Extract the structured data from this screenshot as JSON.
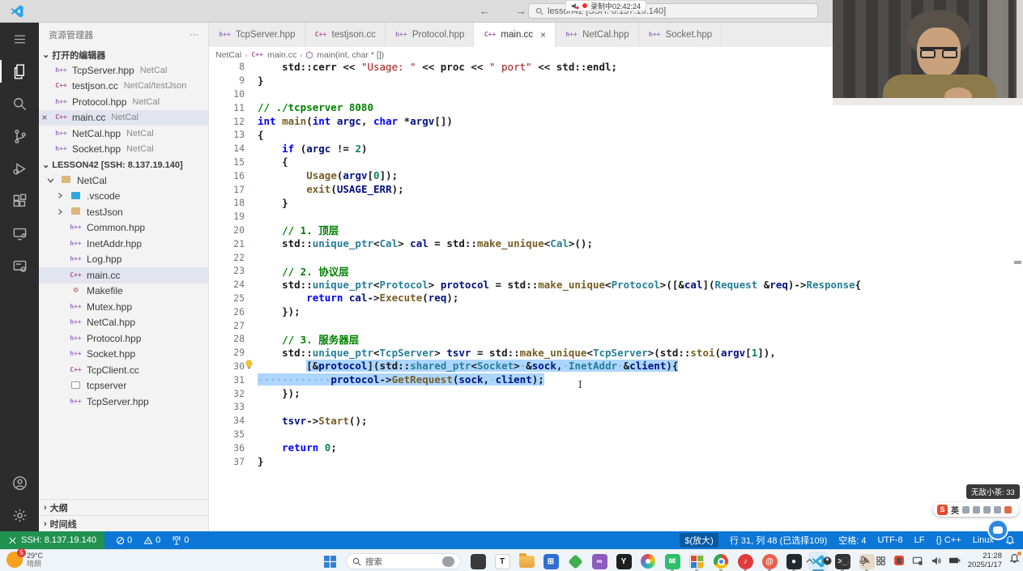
{
  "titlebar": {
    "search": "lesson42 [SSH: 8.137.19.140]",
    "recording": "录制中02:42:24"
  },
  "sidebar": {
    "title": "资源管理器",
    "more": "···",
    "close_glyph": "×",
    "open_editors_label": "打开的编辑器",
    "open_editors": [
      {
        "icon": "hpp",
        "name": "TcpServer.hpp",
        "path": "NetCal"
      },
      {
        "icon": "cc",
        "name": "testjson.cc",
        "path": "NetCal/testJson"
      },
      {
        "icon": "hpp",
        "name": "Protocol.hpp",
        "path": "NetCal"
      },
      {
        "icon": "cc",
        "name": "main.cc",
        "path": "NetCal",
        "active": true
      },
      {
        "icon": "hpp",
        "name": "NetCal.hpp",
        "path": "NetCal"
      },
      {
        "icon": "hpp",
        "name": "Socket.hpp",
        "path": "NetCal"
      }
    ],
    "workspace_label": "LESSON42 [SSH: 8.137.19.140]",
    "tree": [
      {
        "icon": "folder-open",
        "name": "NetCal",
        "level": 0,
        "chevron": "down"
      },
      {
        "icon": "vscode",
        "name": ".vscode",
        "level": 1,
        "chevron": "right"
      },
      {
        "icon": "folder",
        "name": "testJson",
        "level": 1,
        "chevron": "right"
      },
      {
        "icon": "hpp",
        "name": "Common.hpp",
        "level": 1
      },
      {
        "icon": "hpp",
        "name": "InetAddr.hpp",
        "level": 1
      },
      {
        "icon": "hpp",
        "name": "Log.hpp",
        "level": 1
      },
      {
        "icon": "cc",
        "name": "main.cc",
        "level": 1,
        "selected": true
      },
      {
        "icon": "makefile",
        "name": "Makefile",
        "level": 1
      },
      {
        "icon": "hpp",
        "name": "Mutex.hpp",
        "level": 1
      },
      {
        "icon": "hpp",
        "name": "NetCal.hpp",
        "level": 1
      },
      {
        "icon": "hpp",
        "name": "Protocol.hpp",
        "level": 1
      },
      {
        "icon": "hpp",
        "name": "Socket.hpp",
        "level": 1
      },
      {
        "icon": "cc",
        "name": "TcpClient.cc",
        "level": 1
      },
      {
        "icon": "file",
        "name": "tcpserver",
        "level": 1
      },
      {
        "icon": "hpp",
        "name": "TcpServer.hpp",
        "level": 1
      }
    ],
    "outline_label": "大纲",
    "timeline_label": "时间线"
  },
  "tabs": [
    {
      "icon": "hpp",
      "label": "TcpServer.hpp"
    },
    {
      "icon": "cc",
      "label": "testjson.cc"
    },
    {
      "icon": "hpp",
      "label": "Protocol.hpp"
    },
    {
      "icon": "cc",
      "label": "main.cc",
      "active": true,
      "close": "×"
    },
    {
      "icon": "hpp",
      "label": "NetCal.hpp"
    },
    {
      "icon": "hpp",
      "label": "Socket.hpp"
    }
  ],
  "breadcrumb": {
    "items": [
      "NetCal",
      "main.cc",
      "main(int, char * [])"
    ]
  },
  "code": {
    "lines": [
      {
        "n": 8,
        "segs": [
          [
            "    std::cerr << ",
            "d"
          ],
          [
            "\"Usage: \"",
            "s"
          ],
          [
            " << proc << ",
            "d"
          ],
          [
            "\" port\"",
            "s"
          ],
          [
            " << std::endl;",
            "d"
          ]
        ]
      },
      {
        "n": 9,
        "segs": [
          [
            "}",
            "d"
          ]
        ]
      },
      {
        "n": 10,
        "segs": []
      },
      {
        "n": 11,
        "segs": [
          [
            "// ./tcpserver 8080",
            "c"
          ]
        ]
      },
      {
        "n": 12,
        "segs": [
          [
            "int ",
            "k"
          ],
          [
            "main",
            "f"
          ],
          [
            "(",
            "d"
          ],
          [
            "int ",
            "k"
          ],
          [
            "argc",
            "v"
          ],
          [
            ", ",
            "d"
          ],
          [
            "char ",
            "k"
          ],
          [
            "*",
            "d"
          ],
          [
            "argv",
            "v"
          ],
          [
            "[])",
            "d"
          ]
        ]
      },
      {
        "n": 13,
        "segs": [
          [
            "{",
            "d"
          ]
        ]
      },
      {
        "n": 14,
        "segs": [
          [
            "    ",
            "d"
          ],
          [
            "if ",
            "k"
          ],
          [
            "(",
            "d"
          ],
          [
            "argc",
            "v"
          ],
          [
            " != ",
            "d"
          ],
          [
            "2",
            "n"
          ],
          [
            ")",
            "d"
          ]
        ]
      },
      {
        "n": 15,
        "segs": [
          [
            "    {",
            "d"
          ]
        ]
      },
      {
        "n": 16,
        "segs": [
          [
            "        ",
            "d"
          ],
          [
            "Usage",
            "f"
          ],
          [
            "(",
            "d"
          ],
          [
            "argv",
            "v"
          ],
          [
            "[",
            "d"
          ],
          [
            "0",
            "n"
          ],
          [
            "]);",
            "d"
          ]
        ]
      },
      {
        "n": 17,
        "segs": [
          [
            "        ",
            "d"
          ],
          [
            "exit",
            "f"
          ],
          [
            "(",
            "d"
          ],
          [
            "USAGE_ERR",
            "v"
          ],
          [
            ");",
            "d"
          ]
        ]
      },
      {
        "n": 18,
        "segs": [
          [
            "    }",
            "d"
          ]
        ]
      },
      {
        "n": 19,
        "segs": []
      },
      {
        "n": 20,
        "segs": [
          [
            "    ",
            "d"
          ],
          [
            "// 1. 顶层",
            "c"
          ]
        ]
      },
      {
        "n": 21,
        "segs": [
          [
            "    std::",
            "d"
          ],
          [
            "unique_ptr",
            "t"
          ],
          [
            "<",
            "d"
          ],
          [
            "Cal",
            "t"
          ],
          [
            "> ",
            "d"
          ],
          [
            "cal",
            "v"
          ],
          [
            " = std::",
            "d"
          ],
          [
            "make_unique",
            "f"
          ],
          [
            "<",
            "d"
          ],
          [
            "Cal",
            "t"
          ],
          [
            ">();",
            "d"
          ]
        ]
      },
      {
        "n": 22,
        "segs": []
      },
      {
        "n": 23,
        "segs": [
          [
            "    ",
            "d"
          ],
          [
            "// 2. 协议层",
            "c"
          ]
        ]
      },
      {
        "n": 24,
        "segs": [
          [
            "    std::",
            "d"
          ],
          [
            "unique_ptr",
            "t"
          ],
          [
            "<",
            "d"
          ],
          [
            "Protocol",
            "t"
          ],
          [
            "> ",
            "d"
          ],
          [
            "protocol",
            "v"
          ],
          [
            " = std::",
            "d"
          ],
          [
            "make_unique",
            "f"
          ],
          [
            "<",
            "d"
          ],
          [
            "Protocol",
            "t"
          ],
          [
            ">([&",
            "d"
          ],
          [
            "cal",
            "v"
          ],
          [
            "](",
            "d"
          ],
          [
            "Request",
            "t"
          ],
          [
            " &",
            "d"
          ],
          [
            "req",
            "v"
          ],
          [
            ")->",
            "d"
          ],
          [
            "Response",
            "t"
          ],
          [
            "{",
            "d"
          ]
        ]
      },
      {
        "n": 25,
        "segs": [
          [
            "        ",
            "d"
          ],
          [
            "return ",
            "k"
          ],
          [
            "cal",
            "v"
          ],
          [
            "->",
            "d"
          ],
          [
            "Execute",
            "f"
          ],
          [
            "(",
            "d"
          ],
          [
            "req",
            "v"
          ],
          [
            ");",
            "d"
          ]
        ]
      },
      {
        "n": 26,
        "segs": [
          [
            "    });",
            "d"
          ]
        ]
      },
      {
        "n": 27,
        "segs": []
      },
      {
        "n": 28,
        "segs": [
          [
            "    ",
            "d"
          ],
          [
            "// 3. 服务器层",
            "c"
          ]
        ]
      },
      {
        "n": 29,
        "segs": [
          [
            "    std::",
            "d"
          ],
          [
            "unique_ptr",
            "t"
          ],
          [
            "<",
            "d"
          ],
          [
            "TcpServer",
            "t"
          ],
          [
            "> ",
            "d"
          ],
          [
            "tsvr",
            "v"
          ],
          [
            " = std::",
            "d"
          ],
          [
            "make_unique",
            "f"
          ],
          [
            "<",
            "d"
          ],
          [
            "TcpServer",
            "t"
          ],
          [
            ">(std::",
            "d"
          ],
          [
            "stoi",
            "f"
          ],
          [
            "(",
            "d"
          ],
          [
            "argv",
            "v"
          ],
          [
            "[",
            "d"
          ],
          [
            "1",
            "n"
          ],
          [
            "]),",
            "d"
          ]
        ]
      },
      {
        "n": 30,
        "bulb": true,
        "pre": "        ",
        "sel": [
          [
            "[&",
            "d"
          ],
          [
            "protocol",
            "v"
          ],
          [
            "](",
            "d"
          ],
          [
            "std::",
            "d"
          ],
          [
            "shared_ptr",
            "t"
          ],
          [
            "<",
            "d"
          ],
          [
            "Socket",
            "t"
          ],
          [
            ">",
            "d"
          ],
          [
            "·",
            "w"
          ],
          [
            "&",
            "d"
          ],
          [
            "sock",
            "v"
          ],
          [
            ",",
            "d"
          ],
          [
            "·",
            "w"
          ],
          [
            "InetAddr",
            "t"
          ],
          [
            "·",
            "w"
          ],
          [
            "&",
            "d"
          ],
          [
            "client",
            "v"
          ],
          [
            "){",
            "d"
          ]
        ]
      },
      {
        "n": 31,
        "pre": "",
        "sel": [
          [
            "············",
            "w"
          ],
          [
            "protocol",
            "v"
          ],
          [
            "->",
            "d"
          ],
          [
            "GetRequest",
            "f"
          ],
          [
            "(",
            "d"
          ],
          [
            "sock",
            "v"
          ],
          [
            ",",
            "d"
          ],
          [
            "·",
            "w"
          ],
          [
            "client",
            "v"
          ],
          [
            ");",
            "d"
          ]
        ]
      },
      {
        "n": 32,
        "segs": [
          [
            "    });",
            "d"
          ]
        ]
      },
      {
        "n": 33,
        "segs": []
      },
      {
        "n": 34,
        "segs": [
          [
            "    ",
            "d"
          ],
          [
            "tsvr",
            "v"
          ],
          [
            "->",
            "d"
          ],
          [
            "Start",
            "f"
          ],
          [
            "();",
            "d"
          ]
        ]
      },
      {
        "n": 35,
        "segs": []
      },
      {
        "n": 36,
        "segs": [
          [
            "    ",
            "d"
          ],
          [
            "return ",
            "k"
          ],
          [
            "0",
            "n"
          ],
          [
            ";",
            "d"
          ]
        ]
      },
      {
        "n": 37,
        "segs": [
          [
            "}",
            "d"
          ]
        ]
      }
    ]
  },
  "statusbar": {
    "remote": "SSH: 8.137.19.140",
    "errors": "0",
    "warnings": "0",
    "ports": "0",
    "zoom_item": "$(放大)",
    "cursor": "行 31, 列 48 (已选择109)",
    "indent": "空格: 4",
    "encoding": "UTF-8",
    "eol": "LF",
    "lang": "{} C++",
    "os": "Linux"
  },
  "taskbar": {
    "weather": {
      "temp": "29°C",
      "desc": "晴朗",
      "badge": "5"
    },
    "search_placeholder": "搜索",
    "apps": [
      {
        "name": "pinned-app-clip",
        "type": "tile",
        "color": "#3a3a3a",
        "letter": "",
        "lc": "#fff"
      },
      {
        "name": "pinned-app-typora",
        "type": "tile",
        "color": "#ffffff",
        "letter": "T",
        "lc": "#222",
        "border": "#cfcfcf"
      },
      {
        "name": "file-explorer",
        "type": "folder"
      },
      {
        "name": "microsoft-store",
        "type": "tile",
        "color": "#2f6fd0",
        "letter": "⊞",
        "lc": "#fff"
      },
      {
        "name": "pinned-app-diamond",
        "type": "diamond",
        "color": "#3fae4e"
      },
      {
        "name": "visual-studio",
        "type": "tile",
        "color": "#8d5bbf",
        "letter": "∞",
        "lc": "#fff"
      },
      {
        "name": "pinned-app-y",
        "type": "tile",
        "color": "#1f1f1f",
        "letter": "Y",
        "lc": "#fff"
      },
      {
        "name": "photos",
        "type": "swirl"
      },
      {
        "name": "pinned-app-mail",
        "type": "tile",
        "color": "#2fbf6b",
        "letter": "✉",
        "lc": "#fff",
        "dot": true
      },
      {
        "name": "pinned-app-grid",
        "type": "gridtile",
        "dot": true
      },
      {
        "name": "chrome",
        "type": "chrome",
        "dot": true
      },
      {
        "name": "netease-music",
        "type": "tile",
        "round": true,
        "color": "#e03a3a",
        "letter": "♪",
        "lc": "#fff",
        "dot": true
      },
      {
        "name": "pinned-app-snail",
        "type": "tile",
        "round": true,
        "color": "#e8604c",
        "letter": "@",
        "lc": "#fff",
        "dot": true
      },
      {
        "name": "github-desktop",
        "type": "tile",
        "color": "#24292f",
        "letter": "●",
        "lc": "#fff",
        "dot": true
      },
      {
        "name": "vscode",
        "type": "vscode",
        "active": true,
        "dot": true
      },
      {
        "name": "windows-terminal",
        "type": "tile",
        "color": "#333333",
        "letter": ">_",
        "lc": "#fff",
        "dot": true
      },
      {
        "name": "pinned-app-paint",
        "type": "tile",
        "color": "#e7d9c9",
        "letter": "✎",
        "lc": "#7a5c3e",
        "dot": true
      }
    ],
    "tray": [
      "chevron-up",
      "obs",
      "headset",
      "mic",
      "ime",
      "sogou",
      "cast",
      "speaker",
      "battery"
    ],
    "clock": {
      "time": "21:28",
      "date": "2025/1/17"
    }
  },
  "overlays": {
    "gift_tooltip": "无敌小茶: 33",
    "ime": {
      "logo": "S",
      "mode": "英"
    }
  }
}
